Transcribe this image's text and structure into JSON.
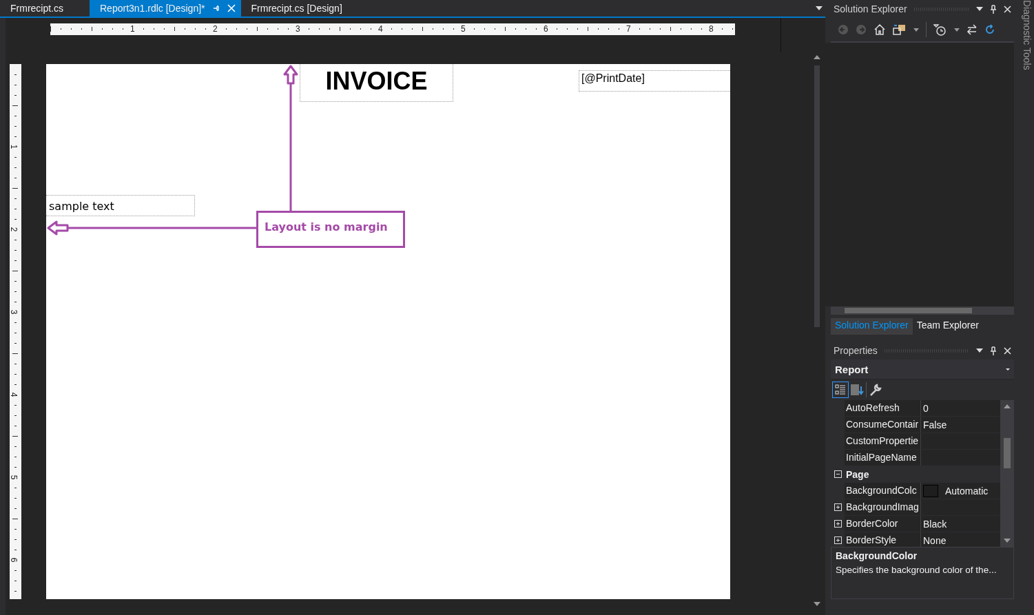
{
  "tabs": [
    {
      "label": "Frmrecipt.cs",
      "selected": false
    },
    {
      "label": "Report3n1.rdlc [Design]*",
      "selected": true
    },
    {
      "label": "Frmrecipt.cs [Design]",
      "selected": false
    }
  ],
  "horizontal_ruler": [
    "1",
    "2",
    "3",
    "4",
    "5",
    "6",
    "7",
    "8"
  ],
  "vertical_ruler": [
    "1",
    "2",
    "3",
    "4",
    "5",
    "6"
  ],
  "report": {
    "title": "INVOICE",
    "print_date": "[@PrintDate]",
    "sample": "sample text"
  },
  "annotation": {
    "text": "Layout is no margin"
  },
  "solution_explorer": {
    "title": "Solution Explorer"
  },
  "side_tabs": [
    {
      "label": "Solution Explorer",
      "selected": true
    },
    {
      "label": "Team Explorer",
      "selected": false
    }
  ],
  "diagnostic_tools": "Diagnostic Tools",
  "properties": {
    "title": "Properties",
    "object": "Report",
    "rows": [
      {
        "kind": "property",
        "name": "AutoRefresh",
        "value": "0"
      },
      {
        "kind": "property",
        "name": "ConsumeContair",
        "value": "False"
      },
      {
        "kind": "property",
        "name": "CustomPropertie"
      },
      {
        "kind": "property",
        "name": "InitialPageName"
      },
      {
        "kind": "category",
        "name": "Page",
        "expanded": true
      },
      {
        "kind": "color",
        "name": "BackgroundColc",
        "value": "Automatic"
      },
      {
        "kind": "property",
        "name": "BackgroundImag",
        "expanded": false
      },
      {
        "kind": "property",
        "name": "BorderColor",
        "value": "Black",
        "expanded": false
      },
      {
        "kind": "property",
        "name": "BorderStyle",
        "value": "None",
        "expanded": false
      }
    ],
    "description_title": "BackgroundColor",
    "description": "Specifies the background color of the..."
  }
}
